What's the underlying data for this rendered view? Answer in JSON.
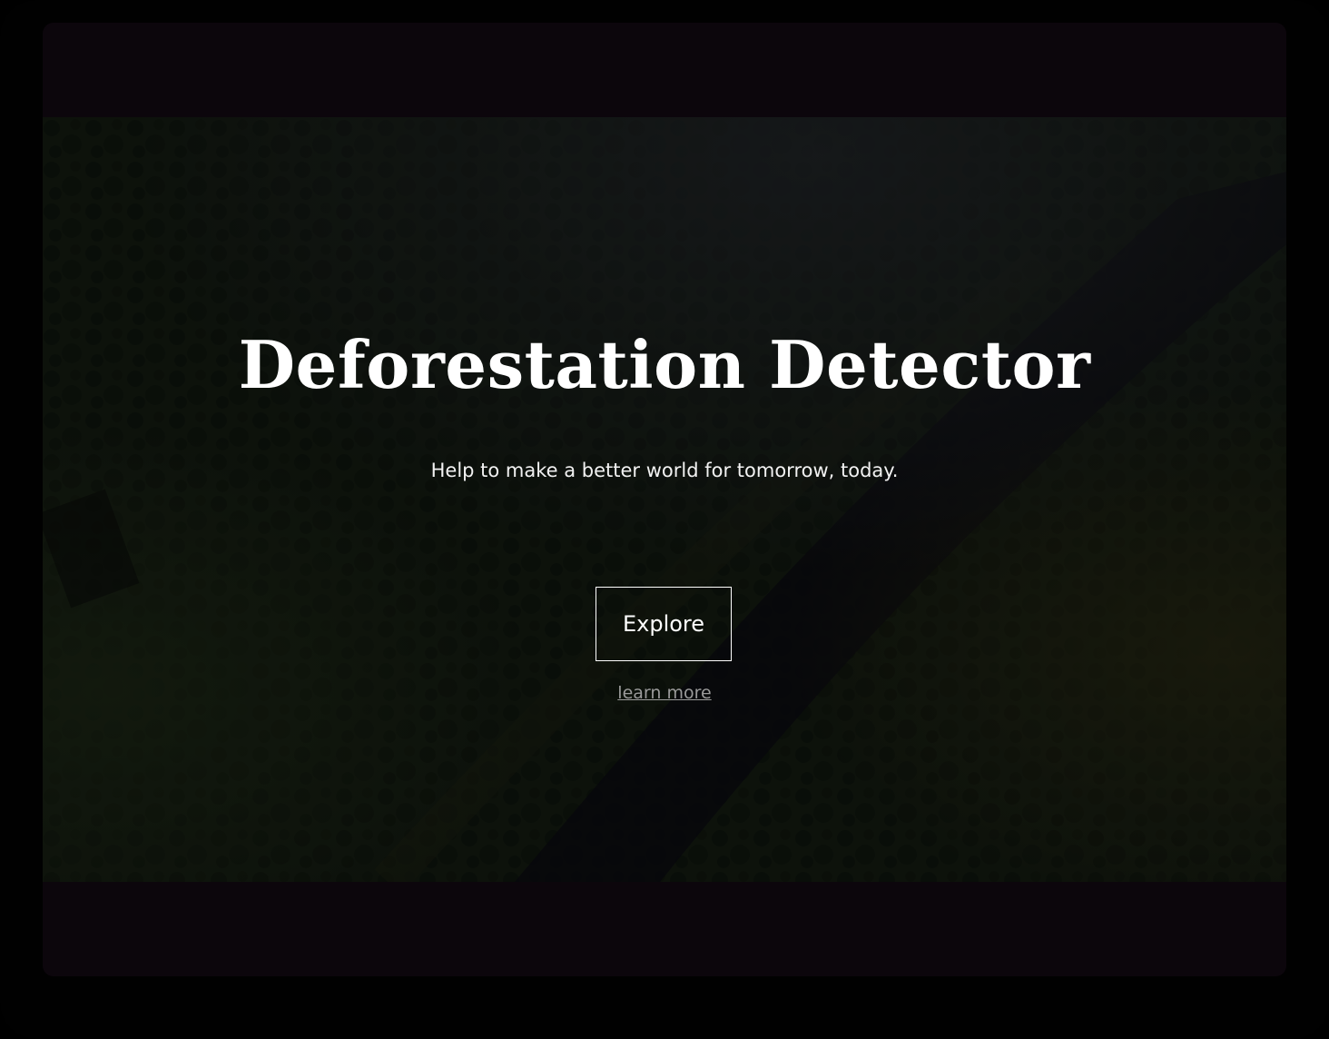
{
  "hero": {
    "title": "Deforestation Detector",
    "subtitle": "Help to make a better world for tomorrow, today.",
    "explore_label": "Explore",
    "learn_more_label": "learn more",
    "background_image": "aerial-forest-photo"
  },
  "colors": {
    "page_background": "#010101",
    "bar_background": "#0c060c",
    "hero_tint": "#121a12",
    "text_primary": "#ffffff",
    "link_muted": "#9a9a9a"
  }
}
